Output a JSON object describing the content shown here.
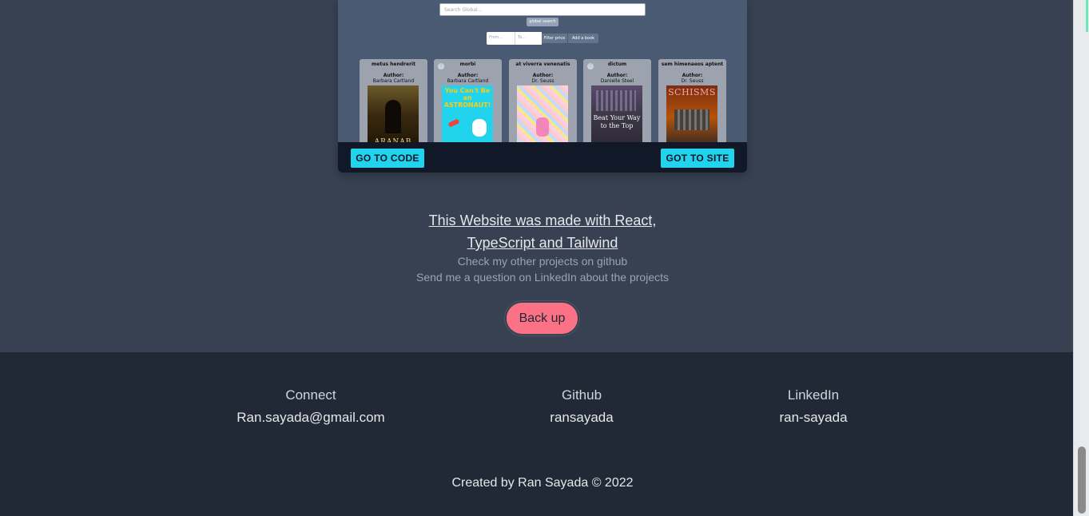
{
  "project_preview": {
    "search_placeholder": "Search Global...",
    "global_search_label": "global search",
    "price_from_placeholder": "From...",
    "price_to_placeholder": "To...",
    "filter_price_label": "Filter price",
    "add_book_label": "Add a book",
    "books": [
      {
        "title": "metus hendrerit",
        "author_label": "Author:",
        "author": "Barbara Cartland",
        "cover_text": "ARANAB",
        "cover_color": "#3b2a10"
      },
      {
        "title": "morbi",
        "author_label": "Author:",
        "author": "Barbara Cartland",
        "cover_text": "You Can't Be an ASTRONAUT!",
        "cover_color": "#22d3ee"
      },
      {
        "title": "at viverra venenatis",
        "author_label": "Author:",
        "author": "Dr. Seuss",
        "cover_text": "",
        "cover_color": "#f5c6d0"
      },
      {
        "title": "dictum",
        "author_label": "Author:",
        "author": "Danielle Steel",
        "cover_text": "Beat Your Way to the Top",
        "cover_color": "#3f3a4a"
      },
      {
        "title": "sem himenaeos aptent",
        "author_label": "Author:",
        "author": "Dr. Seuss",
        "cover_text": "SCHISMS",
        "cover_color": "#7c2d12"
      }
    ]
  },
  "card_actions": {
    "code_label": "GO TO CODE",
    "site_label": "GOT TO SITE"
  },
  "about": {
    "line1": "This Website was made with React,",
    "line2": "TypeScript and Tailwind",
    "github_note": "Check my other projects on github",
    "linkedin_note": "Send me a question on LinkedIn about the projects",
    "back_up_label": "Back up"
  },
  "footer": {
    "connect": {
      "heading": "Connect",
      "value": "Ran.sayada@gmail.com"
    },
    "github": {
      "heading": "Github",
      "value": "ransayada"
    },
    "linkedin": {
      "heading": "LinkedIn",
      "value": "ran-sayada"
    },
    "credits": "Created by Ran Sayada © 2022"
  },
  "colors": {
    "background": "#374151",
    "footer_background": "#222936",
    "cta_accent": "#22d3ee",
    "back_up_button": "#fb7185"
  }
}
